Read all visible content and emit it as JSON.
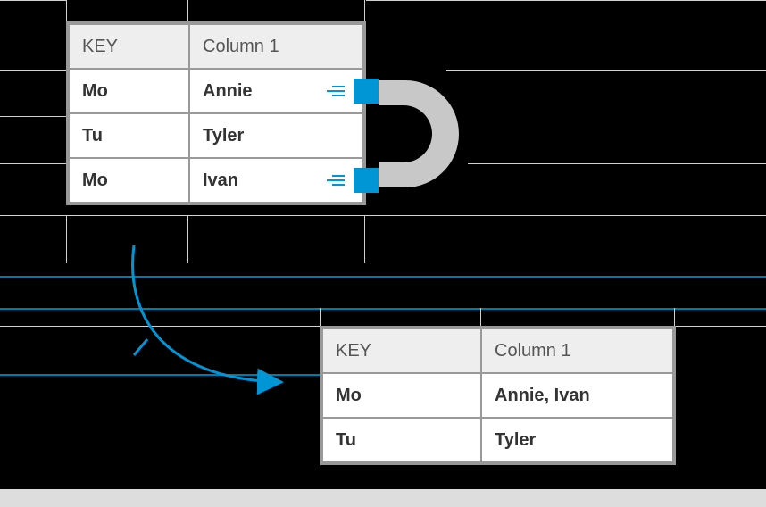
{
  "table1": {
    "headers": {
      "key": "KEY",
      "col1": "Column 1"
    },
    "rows": [
      {
        "key": "Mo",
        "val": "Annie",
        "joined": true
      },
      {
        "key": "Tu",
        "val": "Tyler",
        "joined": false
      },
      {
        "key": "Mo",
        "val": "Ivan",
        "joined": true
      }
    ]
  },
  "table2": {
    "headers": {
      "key": "KEY",
      "col1": "Column 1"
    },
    "rows": [
      {
        "key": "Mo",
        "val": "Annie, Ivan"
      },
      {
        "key": "Tu",
        "val": "Tyler"
      }
    ]
  },
  "colors": {
    "accent": "#0096d6",
    "line": "#d0d0d0"
  }
}
